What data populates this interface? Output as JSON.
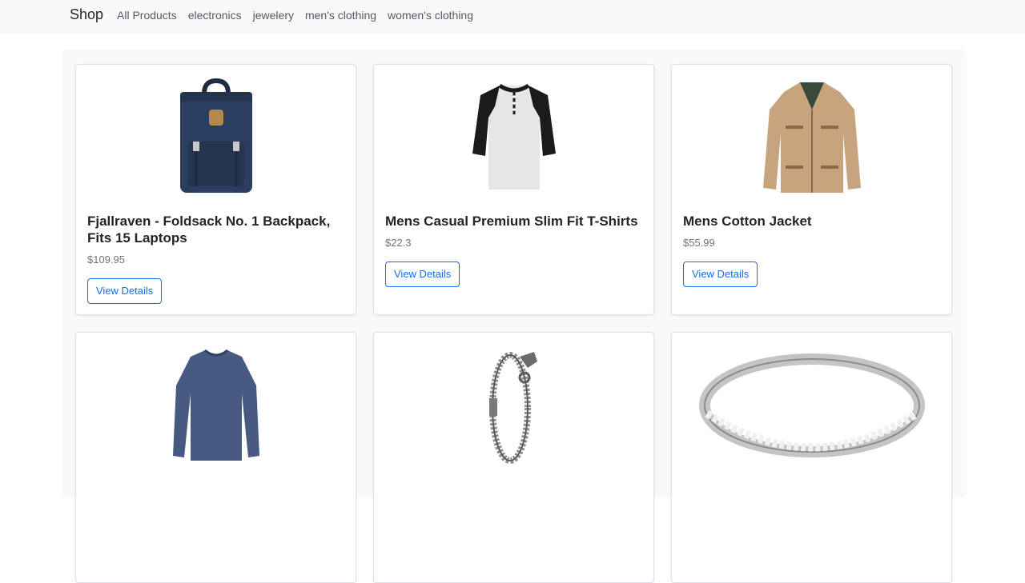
{
  "navbar": {
    "brand": "Shop",
    "links": [
      "All Products",
      "electronics",
      "jewelery",
      "men's clothing",
      "women's clothing"
    ]
  },
  "products": [
    {
      "title": "Fjallraven - Foldsack No. 1 Backpack, Fits 15 Laptops",
      "price": "$109.95",
      "button": "View Details",
      "icon": "backpack-image"
    },
    {
      "title": "Mens Casual Premium Slim Fit T-Shirts",
      "price": "$22.3",
      "button": "View Details",
      "icon": "tshirt-image"
    },
    {
      "title": "Mens Cotton Jacket",
      "price": "$55.99",
      "button": "View Details",
      "icon": "jacket-image"
    },
    {
      "title": "",
      "price": "",
      "button": "",
      "icon": "sweater-image"
    },
    {
      "title": "",
      "price": "",
      "button": "",
      "icon": "bracelet-image"
    },
    {
      "title": "",
      "price": "",
      "button": "",
      "icon": "ring-image"
    }
  ],
  "colors": {
    "navbar_bg": "#f8f9fa",
    "primary": "#0d6efd",
    "muted": "#6c757d"
  }
}
